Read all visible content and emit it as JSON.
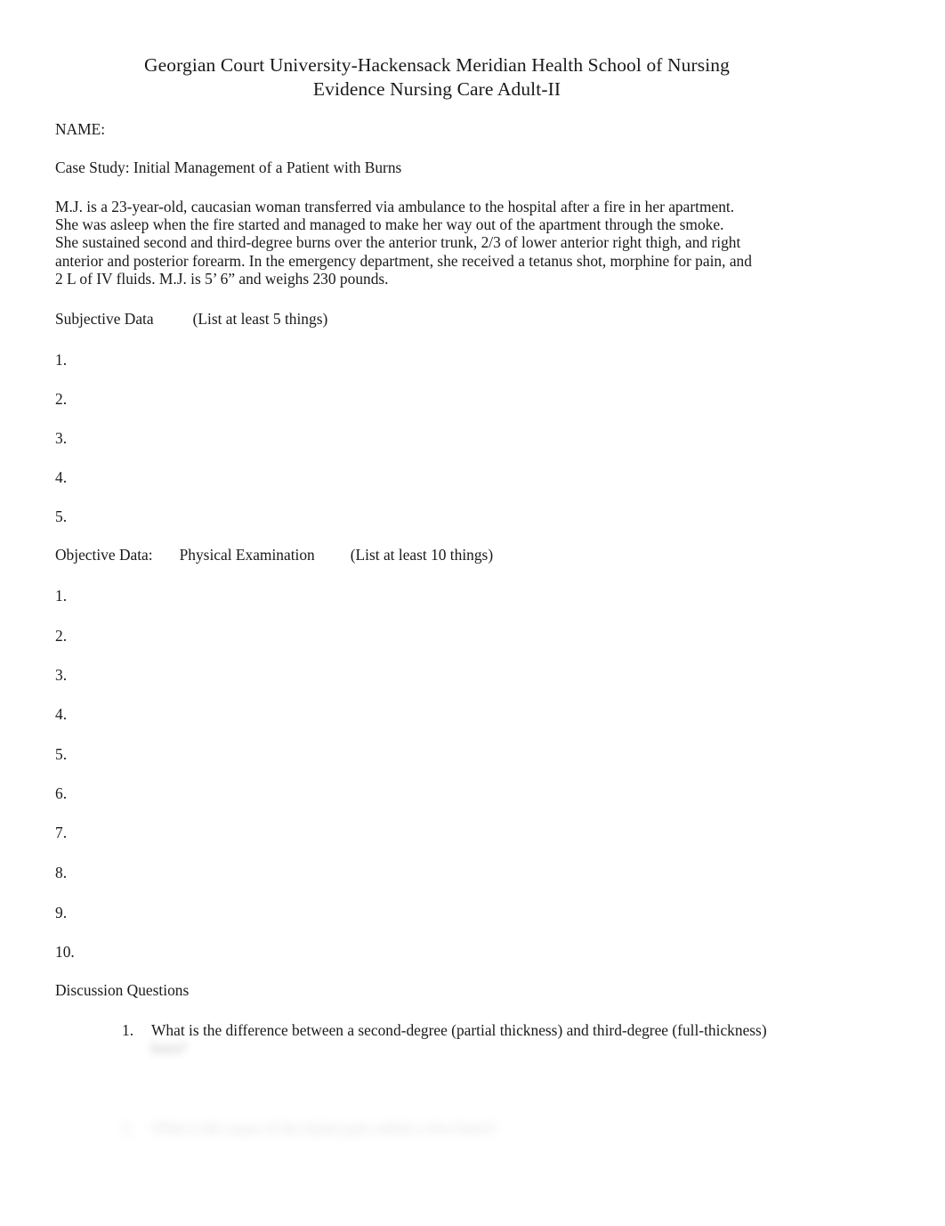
{
  "document": {
    "title_line_1": "Georgian Court University-Hackensack Meridian Health School of Nursing",
    "title_line_2": "Evidence Nursing Care Adult-II",
    "name_label": "NAME:",
    "case_study_label": "Case Study: Initial Management of a Patient with Burns"
  },
  "scenario": {
    "lines": [
      "M.J. is a 23-year-old, caucasian woman transferred via ambulance to the hospital after a fire in her apartment.",
      "She was asleep when the fire started and managed to make her way out of the apartment through the smoke.",
      "She sustained second and third-degree burns over the anterior trunk, 2/3 of lower anterior right thigh, and right",
      "anterior and posterior forearm. In the emergency department, she received a tetanus shot, morphine for pain, and",
      "2 L of IV fluids. M.J. is 5’ 6” and weighs 230 pounds."
    ]
  },
  "subjective": {
    "heading": "Subjective Data",
    "instruction": "(List at least 5 things)",
    "items": [
      "1.",
      "2.",
      "3.",
      "4.",
      "5."
    ]
  },
  "objective": {
    "heading": "Objective Data:",
    "subheading": "Physical Examination",
    "instruction": "(List at least 10 things)",
    "items": [
      "1.",
      "2.",
      "3.",
      "4.",
      "5.",
      "6.",
      "7.",
      "8.",
      "9.",
      "10."
    ]
  },
  "discussion": {
    "heading": "Discussion Questions",
    "questions": [
      {
        "number": "1.",
        "text": "What is the difference between a second-degree (partial thickness) and third-degree (full-thickness)",
        "continuation": "burn?",
        "continuation_blurred": true
      },
      {
        "number": "2.",
        "text": "What is the cause of the initial pain within a few hours?",
        "blurred": true
      }
    ]
  }
}
